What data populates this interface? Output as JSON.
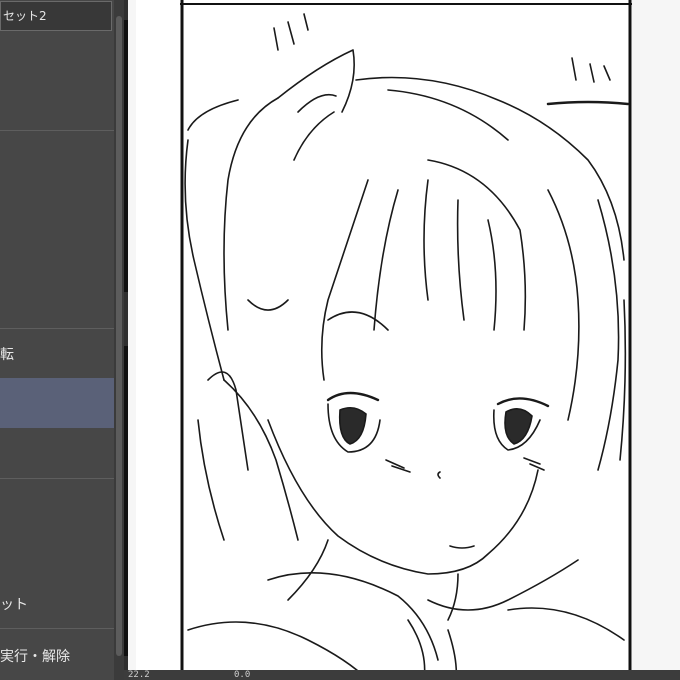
{
  "panel": {
    "set_tab_label": "セット2",
    "items": [
      {
        "label": "転"
      },
      {
        "label": "ット"
      },
      {
        "label": "実行・解除"
      }
    ]
  },
  "status": {
    "zoom": "22.2",
    "rotation": "0.0"
  },
  "colors": {
    "panel_bg": "#474747",
    "selected_row": "#5a6178",
    "canvas_bg": "#ffffff",
    "ink": "#111111"
  }
}
